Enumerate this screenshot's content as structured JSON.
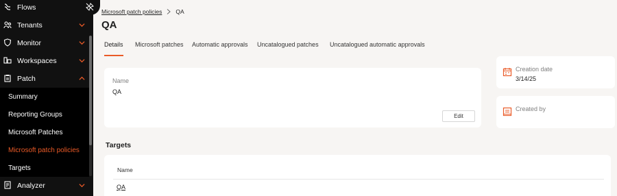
{
  "sidebar": {
    "items": [
      {
        "label": "Flows"
      },
      {
        "label": "Tenants"
      },
      {
        "label": "Monitor"
      },
      {
        "label": "Workspaces"
      },
      {
        "label": "Patch"
      },
      {
        "label": "Analyzer"
      }
    ],
    "patch_subitems": [
      {
        "label": "Summary"
      },
      {
        "label": "Reporting Groups"
      },
      {
        "label": "Microsoft Patches"
      },
      {
        "label": "Microsoft patch policies"
      },
      {
        "label": "Targets"
      }
    ],
    "active_subitem": "Microsoft patch policies"
  },
  "breadcrumb": {
    "parent": "Microsoft patch policies",
    "current": "QA"
  },
  "page": {
    "title": "QA"
  },
  "tabs": [
    {
      "label": "Details"
    },
    {
      "label": "Microsoft patches"
    },
    {
      "label": "Automatic approvals"
    },
    {
      "label": "Uncatalogued patches"
    },
    {
      "label": "Uncatalogued automatic approvals"
    }
  ],
  "details": {
    "name_label": "Name",
    "name_value": "QA",
    "edit_label": "Edit"
  },
  "info": {
    "creation_label": "Creation date",
    "creation_value": "3/14/25",
    "created_by_label": "Created by"
  },
  "targets": {
    "title": "Targets",
    "column_name": "Name",
    "rows": [
      {
        "name": "QA"
      }
    ]
  },
  "colors": {
    "accent": "#ea5a27",
    "sidebar_bg": "#111111",
    "page_bg": "#f7f5f3"
  }
}
